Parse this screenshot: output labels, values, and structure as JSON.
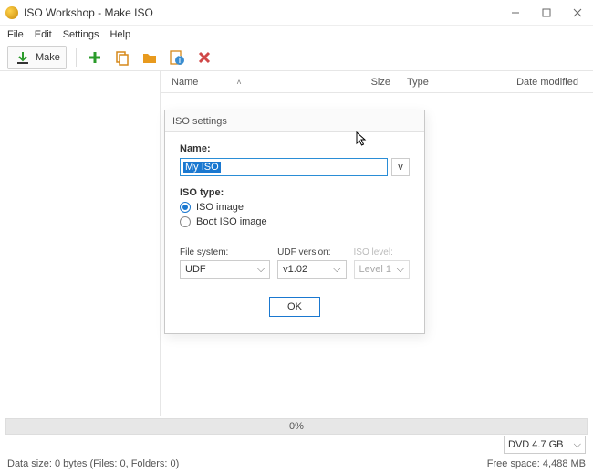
{
  "window": {
    "title": "ISO Workshop - Make ISO"
  },
  "menu": {
    "file": "File",
    "edit": "Edit",
    "settings": "Settings",
    "help": "Help"
  },
  "toolbar": {
    "make": "Make"
  },
  "columns": {
    "name": "Name",
    "size": "Size",
    "type": "Type",
    "date": "Date modified"
  },
  "progress": {
    "text": "0%"
  },
  "disc": {
    "selected": "DVD 4.7 GB"
  },
  "status": {
    "left": "Data size: 0 bytes (Files: 0, Folders: 0)",
    "right": "Free space: 4,488 MB"
  },
  "dialog": {
    "title": "ISO settings",
    "name_label": "Name:",
    "name_value": "My ISO",
    "v_button": "v",
    "iso_type_label": "ISO type:",
    "radio_iso": "ISO image",
    "radio_boot": "Boot ISO image",
    "fs_label": "File system:",
    "fs_value": "UDF",
    "udf_label": "UDF version:",
    "udf_value": "v1.02",
    "isolevel_label": "ISO level:",
    "isolevel_value": "Level 1",
    "ok": "OK"
  }
}
